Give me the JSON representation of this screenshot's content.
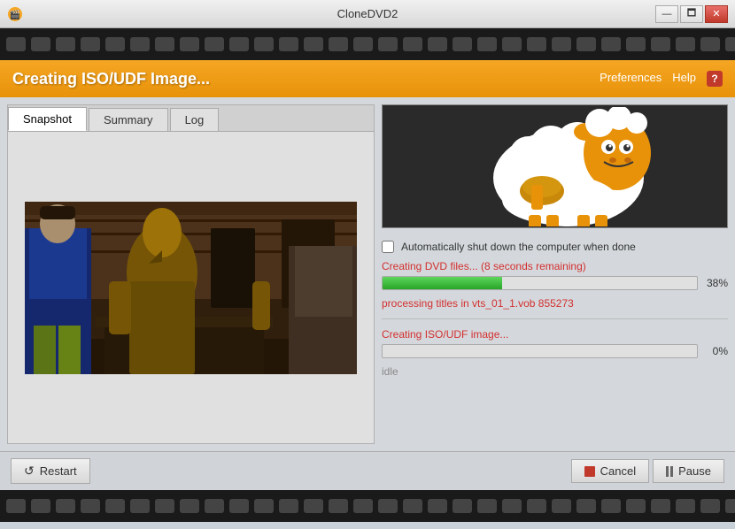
{
  "window": {
    "title": "CloneDVD2",
    "min_label": "—",
    "max_label": "🗖",
    "close_label": "✕"
  },
  "header": {
    "title": "Creating ISO/UDF Image...",
    "preferences": "Preferences",
    "help_text": "Help",
    "help_badge": "?"
  },
  "tabs": [
    {
      "label": "Snapshot",
      "active": true
    },
    {
      "label": "Summary",
      "active": false
    },
    {
      "label": "Log",
      "active": false
    }
  ],
  "checkbox": {
    "label": "Automatically shut down the computer when done",
    "checked": false
  },
  "progress1": {
    "label": "Creating DVD files... (8 seconds remaining)",
    "percent": 38,
    "percent_label": "38%",
    "fill_width": "38"
  },
  "processing": {
    "text": "processing titles in vts_01_1.vob 855273"
  },
  "progress2": {
    "label": "Creating ISO/UDF image...",
    "percent": 0,
    "percent_label": "0%",
    "fill_width": "0"
  },
  "status": {
    "text": "idle"
  },
  "buttons": {
    "restart": "Restart",
    "cancel": "Cancel",
    "pause": "Pause"
  },
  "filmstrip": {
    "hole_count": 30
  }
}
